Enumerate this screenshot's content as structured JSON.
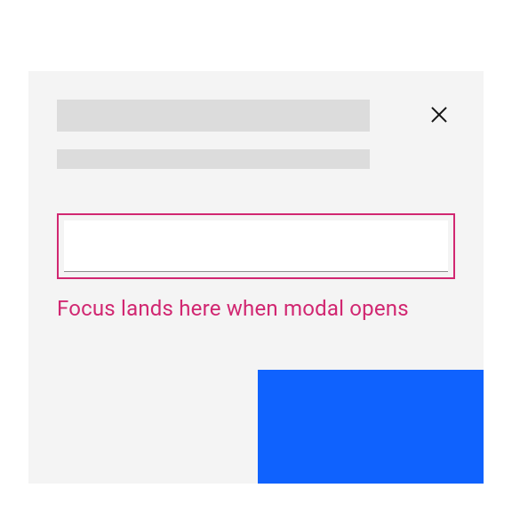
{
  "modal": {
    "title_placeholder": "",
    "subtitle_placeholder": "",
    "close_icon": "close",
    "input": {
      "value": "",
      "placeholder": ""
    },
    "helper_text": "Focus lands here when modal opens",
    "primary_label": ""
  },
  "colors": {
    "accent": "#d12771",
    "primary": "#0f62fe",
    "modal_bg": "#f4f4f4",
    "skeleton": "#dcdcdc"
  }
}
